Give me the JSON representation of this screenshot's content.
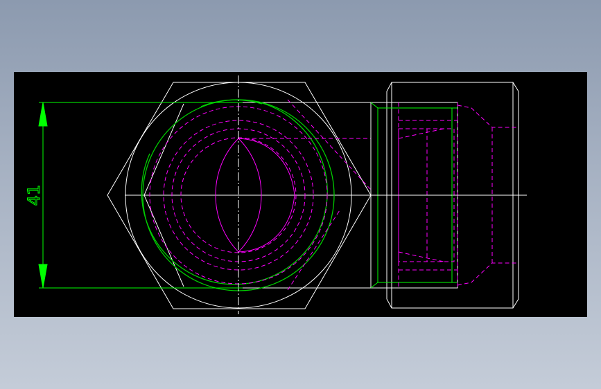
{
  "colors": {
    "background": "#000000",
    "outline": "#ffffff",
    "dimension": "#00ff00",
    "hidden": "#ff00ff",
    "thread": "#00cc00"
  },
  "dimension": {
    "value": "41"
  }
}
